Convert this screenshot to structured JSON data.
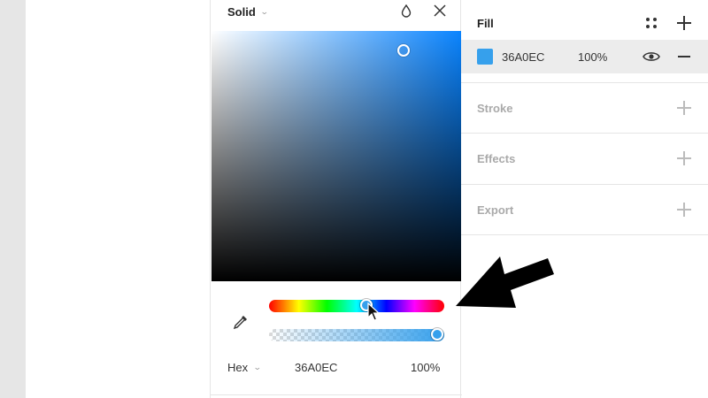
{
  "picker": {
    "mode_label": "Solid",
    "format_label": "Hex",
    "hex_value": "36A0EC",
    "alpha_value": "100%",
    "hue_position": 0.56,
    "alpha_position": 1.0
  },
  "properties": {
    "fill": {
      "title": "Fill",
      "hex": "36A0EC",
      "opacity": "100%",
      "swatch_color": "#36A0EC"
    },
    "stroke_title": "Stroke",
    "effects_title": "Effects",
    "export_title": "Export"
  },
  "colors": {
    "accent": "#36A0EC",
    "muted_text": "#AAAAAA"
  },
  "icons": [
    "chevron-down-icon",
    "drop-icon",
    "close-icon",
    "eyedropper-icon",
    "styles-grid-icon",
    "plus-icon",
    "eye-icon",
    "minus-icon",
    "cursor-icon",
    "annotation-arrow"
  ]
}
